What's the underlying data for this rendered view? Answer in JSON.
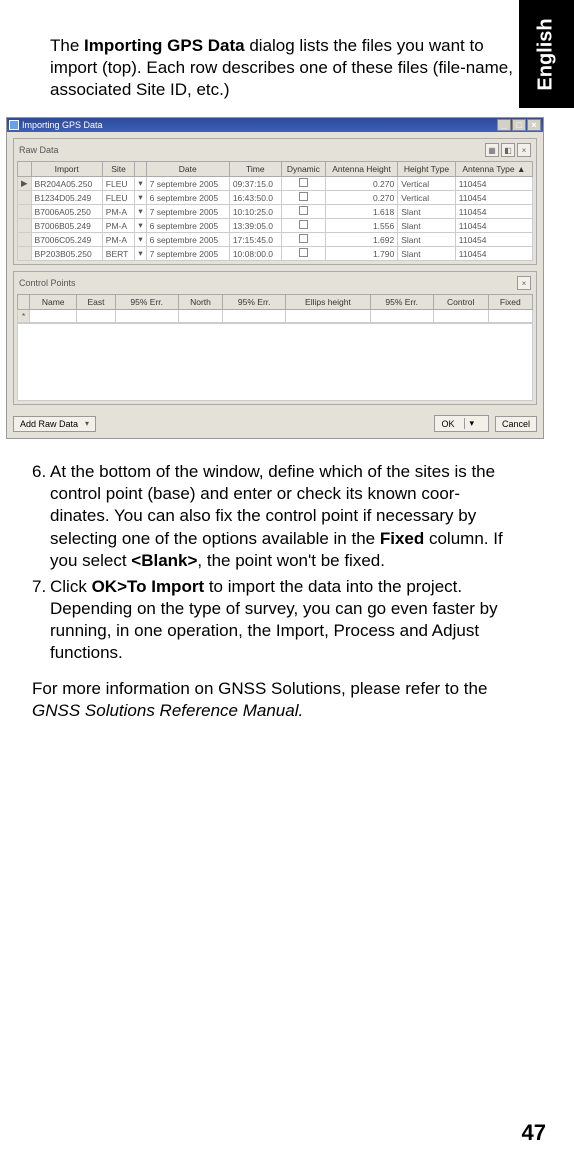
{
  "language_tab": "English",
  "page_number": "47",
  "intro": {
    "prefix": "The ",
    "bold": "Importing GPS Data",
    "suffix": " dialog lists the files you want to import (top). Each row describes one of these files (file-name, associated Site ID, etc.)"
  },
  "screenshot": {
    "title": "Importing GPS Data",
    "win_buttons": [
      "min",
      "restore",
      "close"
    ],
    "raw_data": {
      "label": "Raw Data",
      "columns": [
        "",
        "Import",
        "Site",
        "",
        "Date",
        "Time",
        "Dynamic",
        "Antenna Height",
        "Height Type",
        "Antenna Type ▲"
      ],
      "rows": [
        {
          "selected": true,
          "import": "BR204A05.250",
          "site": "FLEU",
          "date": "7 septembre 2005",
          "time": "09:37:15.0",
          "dynamic": "",
          "height": "0.270",
          "htype": "Vertical",
          "atype": "110454"
        },
        {
          "selected": false,
          "import": "B1234D05.249",
          "site": "FLEU",
          "date": "6 septembre 2005",
          "time": "16:43:50.0",
          "dynamic": "",
          "height": "0.270",
          "htype": "Vertical",
          "atype": "110454"
        },
        {
          "selected": false,
          "import": "B7006A05.250",
          "site": "PM-A",
          "date": "7 septembre 2005",
          "time": "10:10:25.0",
          "dynamic": "",
          "height": "1.618",
          "htype": "Slant",
          "atype": "110454"
        },
        {
          "selected": false,
          "import": "B7006B05.249",
          "site": "PM-A",
          "date": "6 septembre 2005",
          "time": "13:39:05.0",
          "dynamic": "",
          "height": "1.556",
          "htype": "Slant",
          "atype": "110454"
        },
        {
          "selected": false,
          "import": "B7006C05.249",
          "site": "PM-A",
          "date": "6 septembre 2005",
          "time": "17:15:45.0",
          "dynamic": "",
          "height": "1.692",
          "htype": "Slant",
          "atype": "110454"
        },
        {
          "selected": false,
          "import": "BP203B05.250",
          "site": "BERT",
          "date": "7 septembre 2005",
          "time": "10:08:00.0",
          "dynamic": "",
          "height": "1.790",
          "htype": "Slant",
          "atype": "110454"
        }
      ]
    },
    "control_points": {
      "label": "Control Points",
      "columns": [
        "",
        "Name",
        "East",
        "95% Err.",
        "North",
        "95% Err.",
        "Ellips height",
        "95% Err.",
        "Control",
        "Fixed"
      ]
    },
    "footer": {
      "add_raw": "Add Raw Data",
      "ok": "OK",
      "cancel": "Cancel"
    }
  },
  "steps": {
    "six": {
      "num": "6.",
      "t1": "At the bottom of the window, define which of the sites is the control point (base) and enter or check its known coor-dinates. You can also fix the control point if necessary by selecting one of the options available in the ",
      "b1": "Fixed",
      "t2": " column. If you select ",
      "b2": "<Blank>",
      "t3": ", the point won't be fixed."
    },
    "seven": {
      "num": "7.",
      "t1": "Click ",
      "b1": "OK>To Import",
      "t2": " to import the data into the project. Depending on the type of survey, you can go even faster by running, in one operation, the Import, Process and Adjust functions."
    }
  },
  "closing": {
    "t1": "For more information on GNSS Solutions, please refer to the ",
    "i1": "GNSS Solutions Reference Manual."
  }
}
